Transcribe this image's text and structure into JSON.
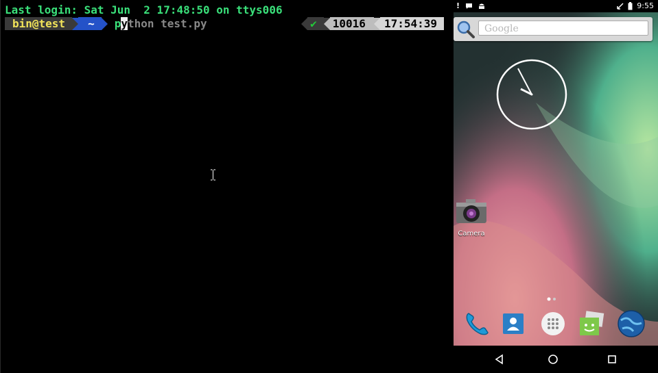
{
  "terminal": {
    "last_login": "Last login: Sat Jun  2 17:48:50 on ttys006",
    "prompt": {
      "user_host": "bin@test",
      "directory": "~",
      "command_typed": "p",
      "command_cursor": "y",
      "command_suggestion": "thon test.py",
      "status_ok": "✔",
      "history_number": "10016",
      "time": "17:54:39"
    },
    "colors": {
      "green": "#3ae07a",
      "blue": "#2452c8",
      "yellow": "#f1e35a"
    }
  },
  "android": {
    "status_bar": {
      "time": "9:55",
      "left_icons": [
        "!",
        "chat-bubble-icon",
        "android-icon"
      ],
      "right_icons": [
        "vibrate-icon",
        "battery-icon"
      ]
    },
    "search": {
      "placeholder": "Google"
    },
    "apps": {
      "camera_label": "Camera"
    },
    "dock": [
      "phone-icon",
      "contacts-icon",
      "app-drawer-icon",
      "messaging-icon",
      "browser-icon"
    ],
    "nav": [
      "back-icon",
      "home-icon",
      "recents-icon"
    ]
  }
}
